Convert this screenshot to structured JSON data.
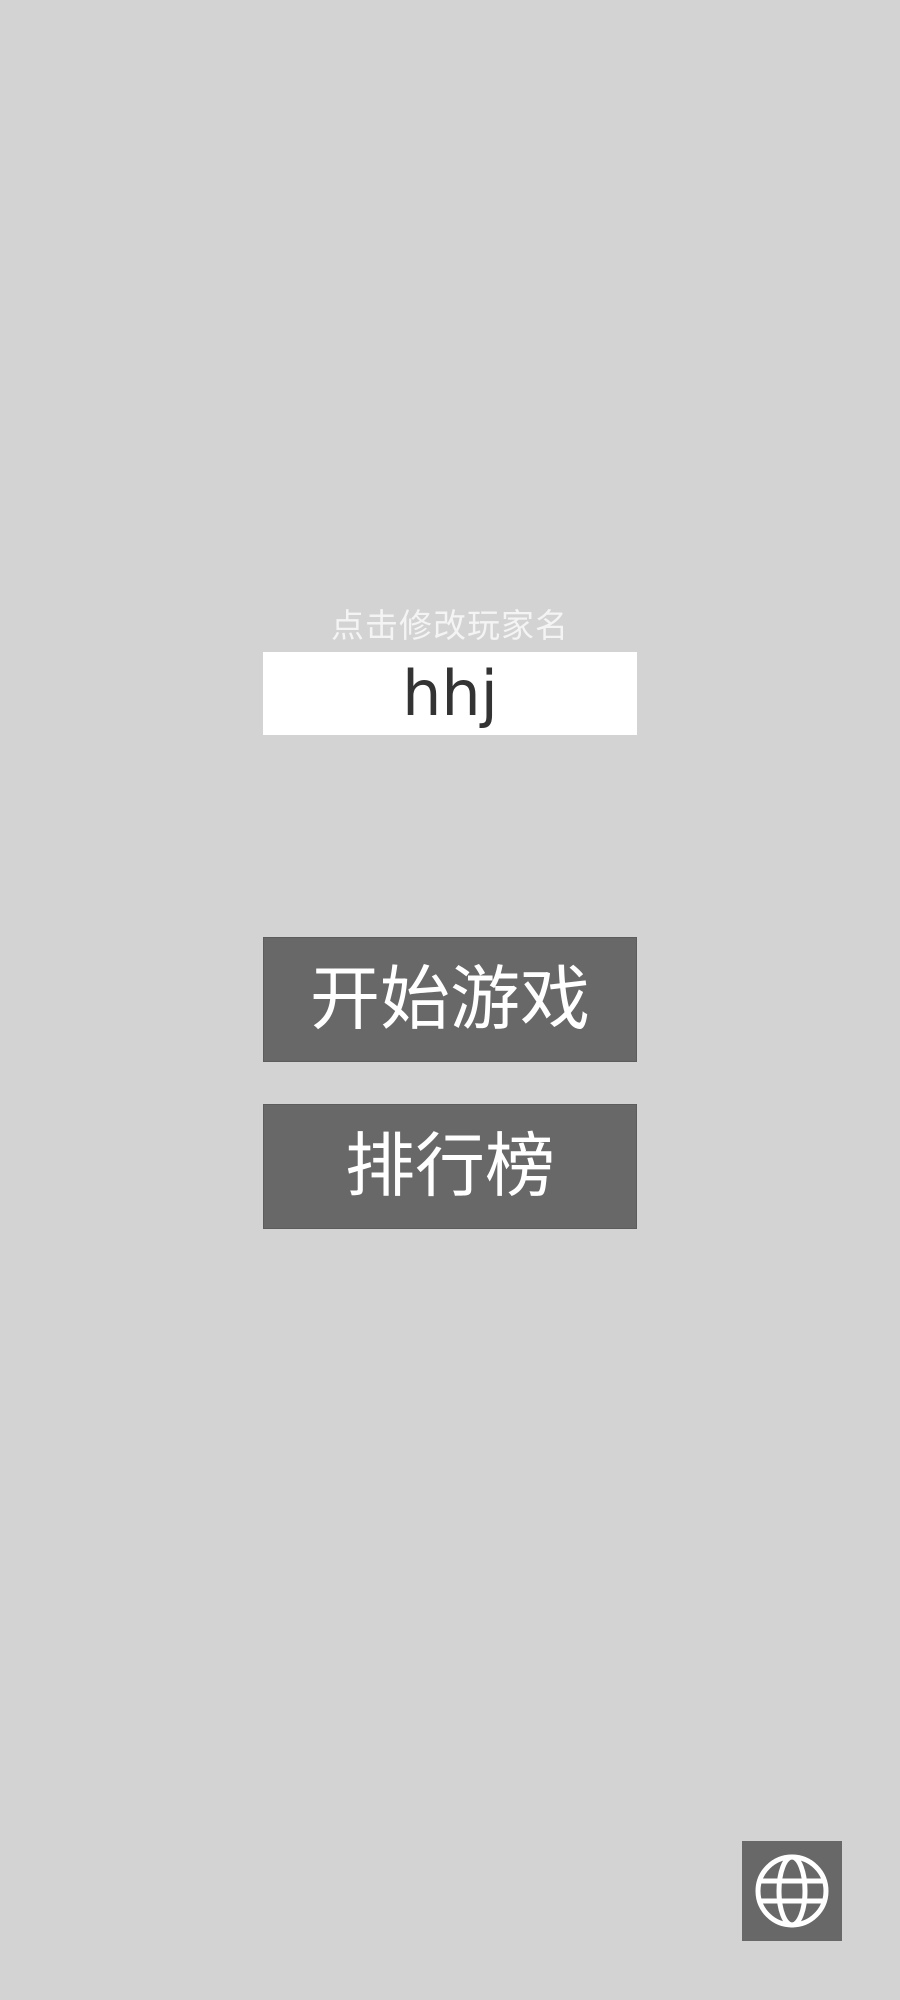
{
  "menu": {
    "name_hint": "点击修改玩家名",
    "player_name": "hhj",
    "start_label": "开始游戏",
    "leaderboard_label": "排行榜"
  },
  "language_button": {
    "icon": "globe-icon"
  },
  "colors": {
    "background": "#d3d3d3",
    "button": "#686868",
    "name_box": "#ffffff",
    "hint_text": "#f4f4f4"
  }
}
